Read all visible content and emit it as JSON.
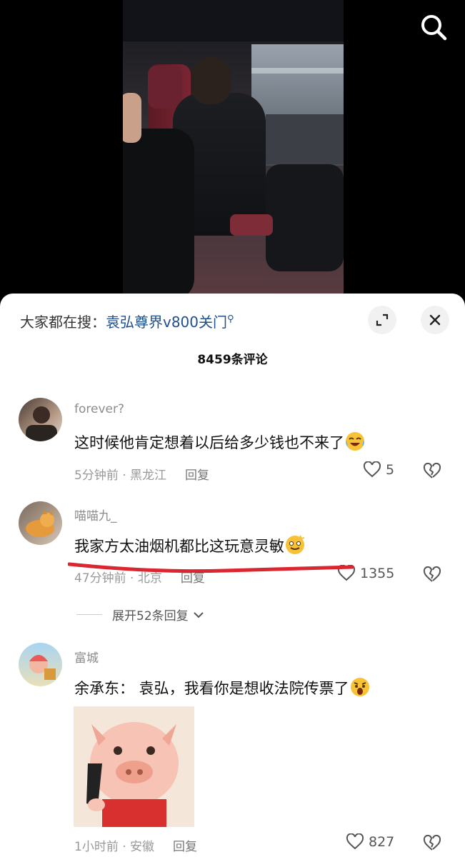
{
  "hot_search": {
    "prefix": "大家都在搜：",
    "term": "袁弘尊界v800关门"
  },
  "comment_count": "8459条评论",
  "expand_replies_label": "展开52条回复",
  "comments": [
    {
      "user": "forever?",
      "text": "这时候他肯定想着以后给多少钱也不来了",
      "time_location": "5分钟前 · 黑龙江",
      "reply": "回复",
      "likes": "5"
    },
    {
      "user": "喵喵九_",
      "text": "我家方太油烟机都比这玩意灵敏",
      "time_location": "47分钟前 · 北京",
      "reply": "回复",
      "likes": "1355"
    },
    {
      "user": "富城",
      "text": "余承东：  袁弘，我看你是想收法院传票了",
      "time_location": "1小时前 · 安徽",
      "reply": "回复",
      "likes": "827"
    }
  ],
  "colors": {
    "accent": "#1f4f8f",
    "annotation": "#d9262f",
    "background": "#ffffff"
  },
  "icons": [
    "search-icon",
    "expand-icon",
    "close-icon",
    "heart-icon",
    "broken-heart-icon",
    "chevron-down-icon",
    "search-magnifier-icon"
  ]
}
